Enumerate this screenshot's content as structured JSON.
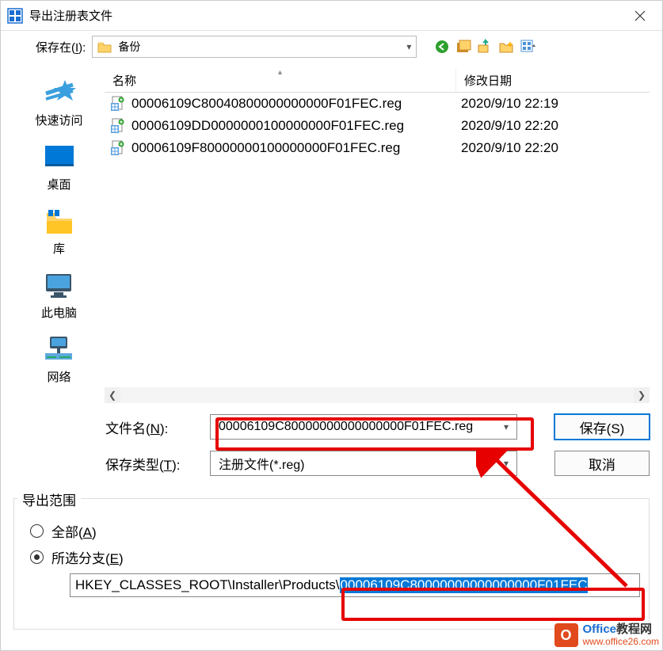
{
  "title": "导出注册表文件",
  "savein": {
    "label_pre": "保存在(",
    "label_u": "I",
    "label_post": "):",
    "folder": "备份"
  },
  "nav_icons": [
    "back-icon",
    "themes-icon",
    "up-icon",
    "new-folder-icon",
    "view-icon"
  ],
  "sidebar": {
    "items": [
      {
        "id": "quickaccess",
        "label": "快速访问"
      },
      {
        "id": "desktop",
        "label": "桌面"
      },
      {
        "id": "libraries",
        "label": "库"
      },
      {
        "id": "thispc",
        "label": "此电脑"
      },
      {
        "id": "network",
        "label": "网络"
      }
    ]
  },
  "filelist": {
    "header_name": "名称",
    "header_date": "修改日期",
    "rows": [
      {
        "name": "00006109C80040800000000000F01FEC.reg",
        "date": "2020/9/10 22:19"
      },
      {
        "name": "00006109DD0000000100000000F01FEC.reg",
        "date": "2020/9/10 22:20"
      },
      {
        "name": "00006109F80000000100000000F01FEC.reg",
        "date": "2020/9/10 22:20"
      }
    ]
  },
  "fields": {
    "filename_label_pre": "文件名(",
    "filename_label_u": "N",
    "filename_label_post": "):",
    "filename_value": "00006109C80000000000000000F01FEC.reg",
    "type_label_pre": "保存类型(",
    "type_label_u": "T",
    "type_label_post": "):",
    "type_value": "注册文件(*.reg)",
    "save_label": "保存(S)",
    "cancel_label": "取消"
  },
  "export": {
    "group_title": "导出范围",
    "all_label_pre": "全部(",
    "all_label_u": "A",
    "all_label_post": ")",
    "branch_label_pre": "所选分支(",
    "branch_label_u": "E",
    "branch_label_post": ")",
    "branch_path_prefix": "HKEY_CLASSES_ROOT\\Installer\\Products\\",
    "branch_path_sel": "00006109C80000000000000000F01FEC"
  },
  "watermark": {
    "line1_a": "Office",
    "line1_b": "教程网",
    "line2": "www.office26.com"
  }
}
